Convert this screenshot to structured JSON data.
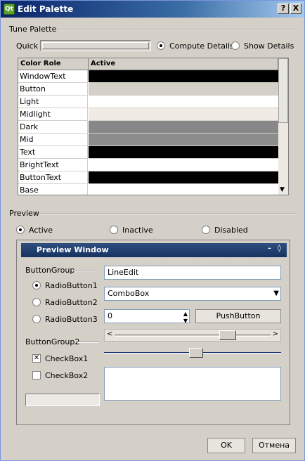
{
  "window": {
    "title": "Edit Palette",
    "help_label": "?",
    "close_label": "X",
    "app_icon_label": "Qt"
  },
  "tune": {
    "section_label": "Tune Palette",
    "quick_label": "Quick",
    "compute_details_label": "Compute Details",
    "show_details_label": "Show Details",
    "selected": "compute_details"
  },
  "table": {
    "headers": [
      "Color Role",
      "Active"
    ],
    "rows": [
      {
        "role": "WindowText",
        "color": "#000000"
      },
      {
        "role": "Button",
        "color": "#d4d0c8"
      },
      {
        "role": "Light",
        "color": "#ffffff"
      },
      {
        "role": "Midlight",
        "color": "#f0ebe5"
      },
      {
        "role": "Dark",
        "color": "#87878a"
      },
      {
        "role": "Mid",
        "color": "#8c8c8c"
      },
      {
        "role": "Text",
        "color": "#000000"
      },
      {
        "role": "BrightText",
        "color": "#ffffff"
      },
      {
        "role": "ButtonText",
        "color": "#000000"
      },
      {
        "role": "Base",
        "color": "#ffffff"
      }
    ]
  },
  "preview": {
    "section_label": "Preview",
    "active_label": "Active",
    "inactive_label": "Inactive",
    "disabled_label": "Disabled",
    "selected": "active",
    "window_title": "Preview Window",
    "window_controls": [
      "–",
      "◊"
    ],
    "buttongroup_label": "ButtonGroup",
    "radio_buttons": [
      "RadioButton1",
      "RadioButton2",
      "RadioButton3"
    ],
    "radio_selected": 0,
    "buttongroup2_label": "ButtonGroup2",
    "checkboxes": [
      {
        "label": "CheckBox1",
        "checked": true
      },
      {
        "label": "CheckBox2",
        "checked": false
      }
    ],
    "lineedit_value": "LineEdit",
    "combobox_value": "ComboBox",
    "spinbox_value": "0",
    "pushbutton_label": "PushButton",
    "horizontal_scroll_value": 0.75,
    "slider_value": 0.52
  },
  "buttons": {
    "ok_label": "OK",
    "cancel_label": "Отмена"
  }
}
